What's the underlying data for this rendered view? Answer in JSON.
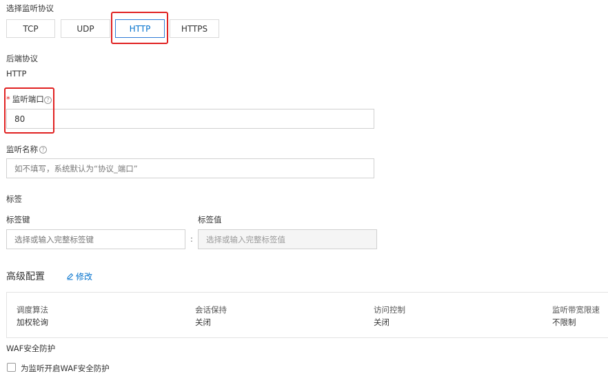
{
  "protocol": {
    "label": "选择监听协议",
    "options": [
      "TCP",
      "UDP",
      "HTTP",
      "HTTPS"
    ],
    "selected": "HTTP"
  },
  "backend": {
    "label": "后端协议",
    "value": "HTTP"
  },
  "port": {
    "required_mark": "*",
    "label": "监听端口",
    "value": "80"
  },
  "name": {
    "label": "监听名称",
    "placeholder": "如不填写，系统默认为“协议_端口”"
  },
  "tags": {
    "title": "标签",
    "key_label": "标签键",
    "value_label": "标签值",
    "key_placeholder": "选择或输入完整标签键",
    "separator": ":",
    "value_placeholder": "选择或输入完整标签值"
  },
  "advanced": {
    "title": "高级配置",
    "edit_label": "修改",
    "items": [
      {
        "title": "调度算法",
        "value": "加权轮询"
      },
      {
        "title": "会话保持",
        "value": "关闭"
      },
      {
        "title": "访问控制",
        "value": "关闭"
      },
      {
        "title": "监听带宽限速",
        "value": "不限制"
      }
    ]
  },
  "waf": {
    "title": "WAF安全防护",
    "checkbox_label": "为监听开启WAF安全防护",
    "checked": false
  },
  "colors": {
    "accent": "#0070cc",
    "highlight": "#e02020"
  },
  "icons": {
    "help": "question-circle-icon",
    "edit": "pencil-icon"
  }
}
